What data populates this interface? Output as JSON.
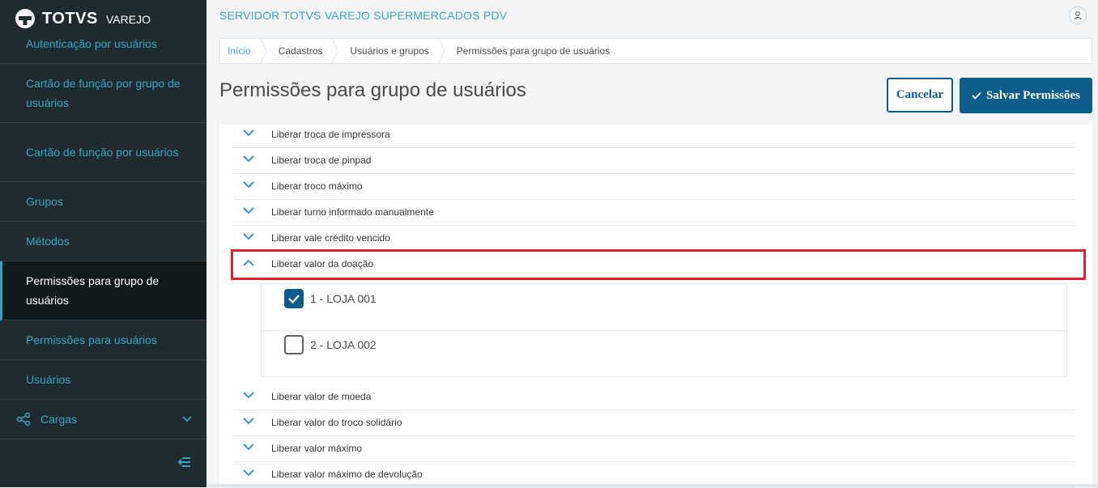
{
  "brand": {
    "name": "TOTVS",
    "sub": "VAREJO"
  },
  "sidebar": {
    "items": [
      {
        "label": "Autenticação por usuários"
      },
      {
        "label": "Cartão de função por grupo de usuários"
      },
      {
        "label": "Cartão de função por usuários"
      },
      {
        "label": "Grupos"
      },
      {
        "label": "Métodos"
      },
      {
        "label": "Permissões para grupo de usuários",
        "active": true
      },
      {
        "label": "Permissões para usuários"
      },
      {
        "label": "Usuários"
      },
      {
        "label": "Cargas",
        "icon": "share-icon"
      }
    ]
  },
  "header": {
    "server": "SERVIDOR TOTVS VAREJO SUPERMERCADOS PDV"
  },
  "breadcrumb": [
    "Início",
    "Cadastros",
    "Usuários e grupos",
    "Permissões para grupo de usuários"
  ],
  "page": {
    "title": "Permissões para grupo de usuários"
  },
  "actions": {
    "cancel": "Cancelar",
    "save": "Salvar Permissões"
  },
  "permissions": {
    "above": [
      {
        "label": "Liberar troca de impressora"
      },
      {
        "label": "Liberar troca de pinpad"
      },
      {
        "label": "Liberar troco máximo"
      },
      {
        "label": "Liberar turno informado manualmente"
      },
      {
        "label": "Liberar vale crédito vencido"
      }
    ],
    "expanded": {
      "label": "Liberar valor da doação",
      "stores": [
        {
          "label": "1 - LOJA 001",
          "checked": true
        },
        {
          "label": "2 - LOJA 002",
          "checked": false
        }
      ]
    },
    "below": [
      {
        "label": "Liberar valor de moeda"
      },
      {
        "label": "Liberar valor do troco solidário"
      },
      {
        "label": "Liberar valor máximo"
      },
      {
        "label": "Liberar valor máximo de devolução"
      }
    ]
  },
  "colors": {
    "accent": "#3aa6c8",
    "primary": "#0c5d8c",
    "sidebar": "#1f2b2e",
    "highlight": "#e0202b"
  }
}
